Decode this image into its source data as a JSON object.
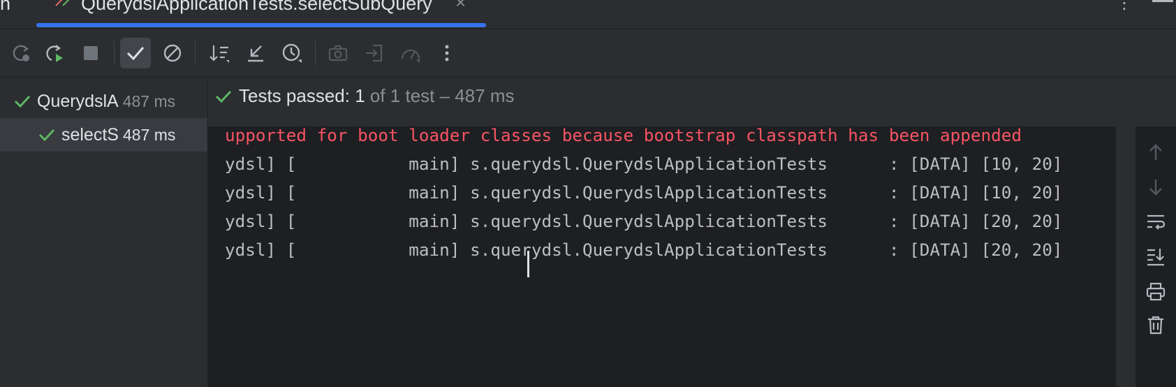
{
  "tabbar": {
    "cut_label": "n",
    "tab_title": "QuerydslApplicationTests.selectSubQuery",
    "tab_close": "×",
    "more": "⋮"
  },
  "toolbar": {
    "icons": [
      "rerun-icon",
      "rerun-failed-icon",
      "stop-icon",
      "show-passed-icon",
      "show-ignored-icon",
      "sort-alphabetically-icon",
      "collapse-icon",
      "sort-by-duration-icon",
      "screenshot-icon",
      "import-tests-icon",
      "performance-icon",
      "more-options-icon"
    ]
  },
  "tree": {
    "root": {
      "name": "QuerydslA",
      "time": "487 ms"
    },
    "child": {
      "name": "selectS",
      "time": "487 ms"
    }
  },
  "status": {
    "main": "Tests passed: 1",
    "sub": " of 1 test – 487 ms"
  },
  "console": {
    "lines": [
      {
        "text": "upported for boot loader classes because bootstrap classpath has been appended",
        "kind": "error"
      },
      {
        "text": "ydsl] [           main] s.querydsl.QuerydslApplicationTests      : [DATA] [10, 20]",
        "kind": "info"
      },
      {
        "text": "ydsl] [           main] s.querydsl.QuerydslApplicationTests      : [DATA] [10, 20]",
        "kind": "info"
      },
      {
        "text": "ydsl] [           main] s.querydsl.QuerydslApplicationTests      : [DATA] [20, 20]",
        "kind": "info"
      },
      {
        "text": "ydsl] [           main] s.querydsl.QuerydslApplicationTests      : [DATA] [20, 20]",
        "kind": "info"
      }
    ]
  },
  "colors": {
    "accent": "#3574f0",
    "passed": "#5fb865",
    "error": "#f75464"
  }
}
